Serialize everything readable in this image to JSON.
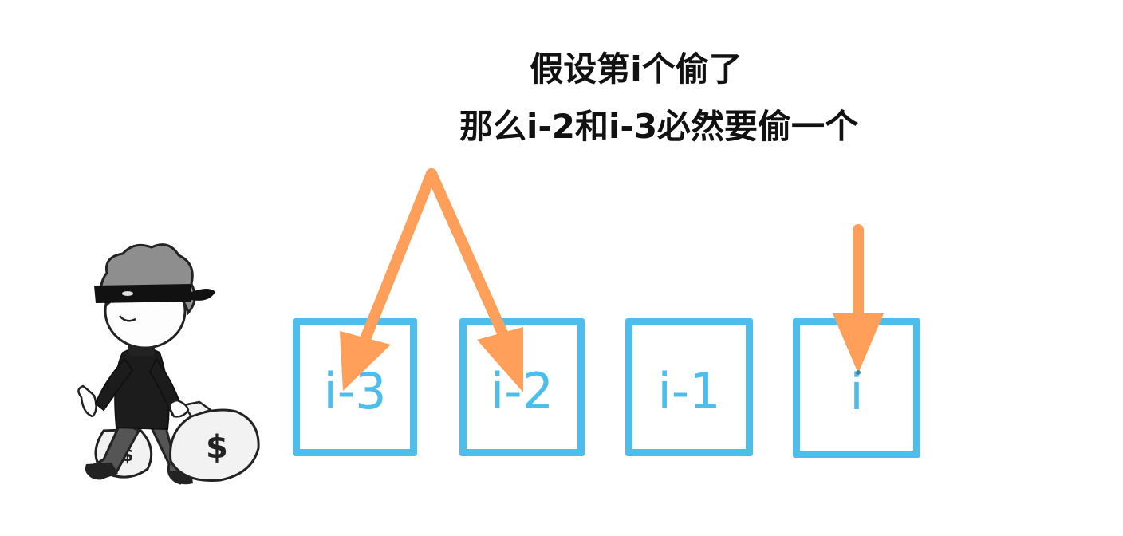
{
  "caption": {
    "line1": "假设第i个偷了",
    "line2": "那么i-2和i-3必然要偷一个"
  },
  "houses": [
    {
      "label": "i-3"
    },
    {
      "label": "i-2"
    },
    {
      "label": "i-1"
    },
    {
      "label": "i"
    }
  ],
  "colors": {
    "house_border": "#4dbeeb",
    "arrow": "#ff9f5a",
    "text": "#111111"
  },
  "illustration": {
    "icon": "thief-with-money-bags-icon",
    "bag_text": "$"
  }
}
